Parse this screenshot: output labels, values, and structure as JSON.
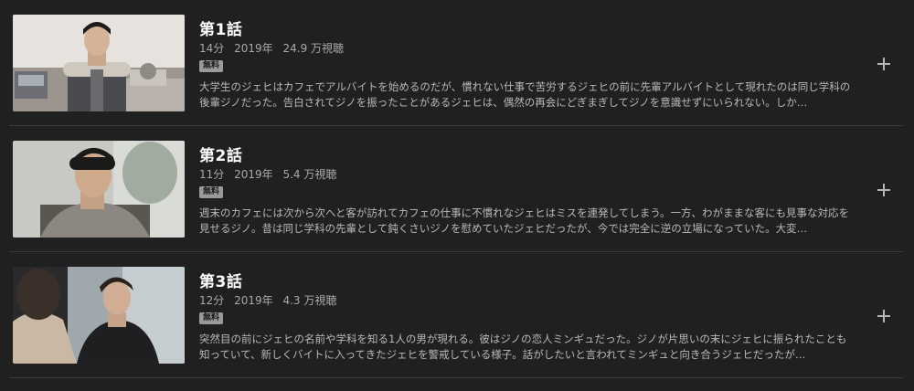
{
  "episodes": [
    {
      "title": "第1話",
      "duration": "14分",
      "year": "2019年",
      "views": "24.9 万視聴",
      "badge": "無料",
      "description": "大学生のジェヒはカフェでアルバイトを始めるのだが、慣れない仕事で苦労するジェヒの前に先輩アルバイトとして現れたのは同じ学科の後輩ジノだった。告白されてジノを振ったことがあるジェヒは、偶然の再会にどぎまぎしてジノを意識せずにいられない。しか…",
      "thumbnail_icon": "episode-1-thumbnail"
    },
    {
      "title": "第2話",
      "duration": "11分",
      "year": "2019年",
      "views": "5.4 万視聴",
      "badge": "無料",
      "description": "週末のカフェには次から次へと客が訪れてカフェの仕事に不慣れなジェヒはミスを連発してしまう。一方、わがままな客にも見事な対応を見せるジノ。昔は同じ学科の先輩として鈍くさいジノを慰めていたジェヒだったが、今では完全に逆の立場になっていた。大変…",
      "thumbnail_icon": "episode-2-thumbnail"
    },
    {
      "title": "第3話",
      "duration": "12分",
      "year": "2019年",
      "views": "4.3 万視聴",
      "badge": "無料",
      "description": "突然目の前にジェヒの名前や学科を知る1人の男が現れる。彼はジノの恋人ミンギュだった。ジノが片思いの末にジェヒに振られたことも知っていて、新しくバイトに入ってきたジェヒを警戒している様子。話がしたいと言われてミンギュと向き合うジェヒだったが…",
      "thumbnail_icon": "episode-3-thumbnail"
    }
  ],
  "add_icon": "plus-icon"
}
